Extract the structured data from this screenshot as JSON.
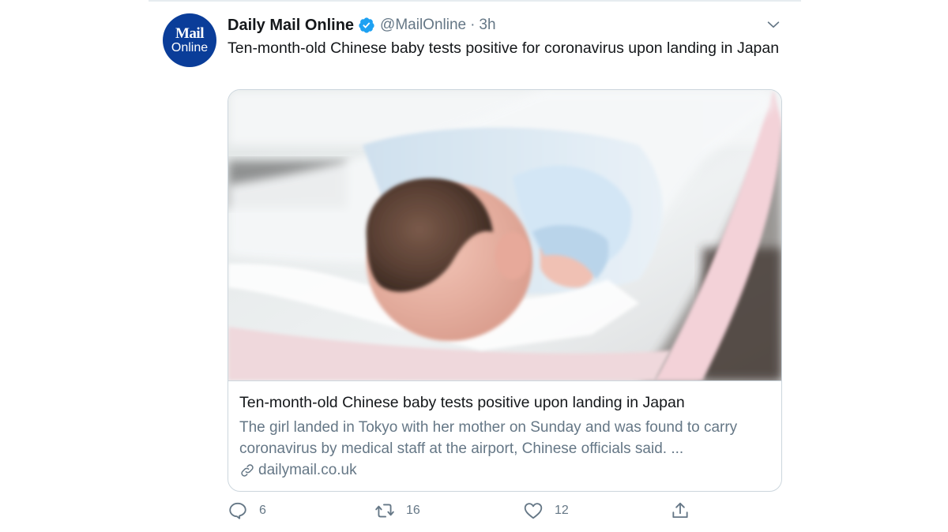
{
  "tweet": {
    "avatar": {
      "line1": "Mail",
      "line2": "Online",
      "color": "#0a3d99"
    },
    "display_name": "Daily Mail Online",
    "verified_icon": "verified-badge-icon",
    "handle": "@MailOnline",
    "separator": "·",
    "time": "3h",
    "text": "Ten-month-old Chinese baby tests positive for coronavirus upon landing in Japan",
    "menu_icon": "chevron-down-icon"
  },
  "card": {
    "image_alt": "photo of a newborn baby sleeping in a hospital crib",
    "title": "Ten-month-old Chinese baby tests positive upon landing in Japan",
    "description": "The girl landed in Tokyo with her mother on Sunday and was found to carry coronavirus by medical staff at the airport, Chinese officials said. ...",
    "link_icon": "link-icon",
    "domain": "dailymail.co.uk"
  },
  "actions": {
    "reply": {
      "icon": "reply-icon",
      "count": "6"
    },
    "retweet": {
      "icon": "retweet-icon",
      "count": "16"
    },
    "like": {
      "icon": "heart-icon",
      "count": "12"
    },
    "share": {
      "icon": "share-icon"
    }
  },
  "colors": {
    "text": "#14171a",
    "secondary": "#657786",
    "verified": "#1da1f2",
    "border": "#ccd6dd"
  }
}
